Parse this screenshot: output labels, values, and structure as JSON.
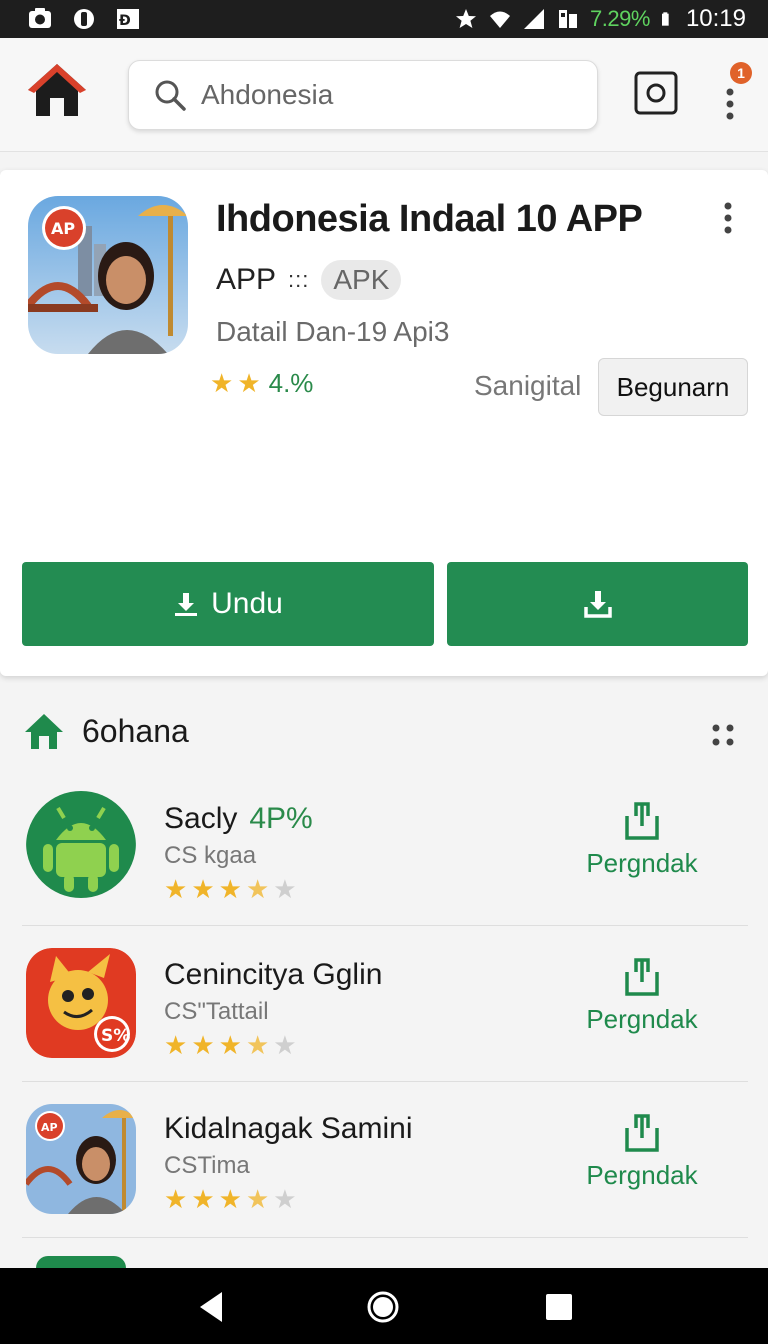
{
  "status_bar": {
    "battery_percent": "7.29%",
    "time": "10:19"
  },
  "app_bar": {
    "search_placeholder": "Ahdonesia",
    "notification_count": "1"
  },
  "app_header": {
    "title": "Ihdonesia Indaal 10 APP",
    "type_label": "APP",
    "type_dots": ":::",
    "chip_label": "APK",
    "detail_line": "Datail Dan-19 Api3",
    "rating_stars": 2,
    "rating_value": "4.%",
    "developer": "Sanigital",
    "action_button": "Begunarn",
    "download_button": "Undu"
  },
  "section": {
    "title": "6ohana"
  },
  "list": [
    {
      "name": "Sacly",
      "badge": "4P%",
      "subtitle": "CS kgaa",
      "rating": 3.5,
      "action": "Pergndak"
    },
    {
      "name": "Cenincitya Gglin",
      "badge": "",
      "subtitle": "CS\"Tattail",
      "rating": 3.5,
      "action": "Pergndak"
    },
    {
      "name": "Kidalnagak Samini",
      "badge": "",
      "subtitle": "CSTima",
      "rating": 3.5,
      "action": "Pergndak"
    }
  ],
  "colors": {
    "accent_green": "#238c52",
    "star_gold": "#f0b429",
    "home_red": "#d9412b"
  },
  "icons": {
    "home": "home-icon",
    "search": "search-icon",
    "camera": "camera-icon",
    "menu": "kebab-menu-icon",
    "download": "download-icon",
    "install": "install-icon"
  }
}
